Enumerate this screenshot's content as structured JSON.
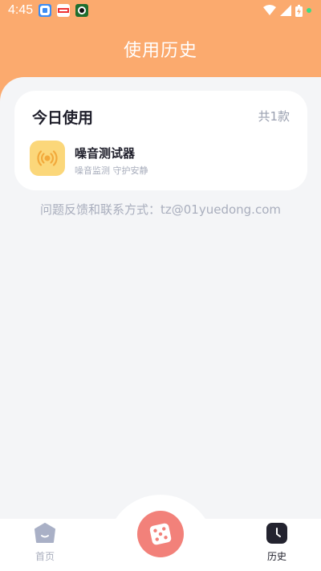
{
  "status_bar": {
    "time": "4:45"
  },
  "header": {
    "title": "使用历史"
  },
  "today_card": {
    "title": "今日使用",
    "count": "共1款",
    "items": [
      {
        "name": "噪音测试器",
        "description": "噪音监测 守护安静",
        "icon": "noise-meter-icon"
      }
    ]
  },
  "feedback": {
    "text": "问题反馈和联系方式：tz@01yuedong.com"
  },
  "tab_bar": {
    "home_label": "首页",
    "history_label": "历史",
    "center_icon": "dice-icon"
  },
  "colors": {
    "header": "#FBAA6E",
    "background": "#F4F5F7",
    "app_icon_bg": "#FBD77A",
    "center_button": "#F2817A",
    "muted_text": "#A9AEBD"
  }
}
